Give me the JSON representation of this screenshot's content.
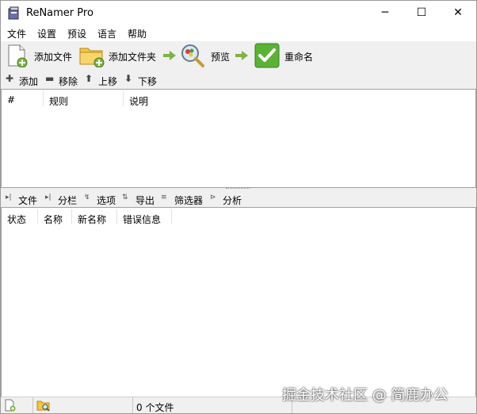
{
  "window": {
    "title": "ReNamer Pro",
    "minimize_glyph": "─",
    "maximize_glyph": "☐",
    "close_glyph": "✕"
  },
  "menu": {
    "items": [
      "文件",
      "设置",
      "预设",
      "语言",
      "帮助"
    ]
  },
  "toolbar": {
    "add_files": "添加文件",
    "add_folder": "添加文件夹",
    "preview": "预览",
    "rename": "重命名",
    "icons": [
      "add-file-icon",
      "add-folder-icon",
      "magnifier-icon",
      "checkmark-icon"
    ]
  },
  "rule_actions": {
    "add": "添加",
    "remove": "移除",
    "up": "上移",
    "down": "下移",
    "glyphs": {
      "add": "✚",
      "remove": "▬",
      "up": "⬆",
      "down": "⬇"
    }
  },
  "rules_table": {
    "columns": [
      "#",
      "规则",
      "说明"
    ],
    "rows": []
  },
  "file_tabs": {
    "items": [
      "文件",
      "分栏",
      "选项",
      "导出",
      "筛选器",
      "分析"
    ],
    "glyphs": [
      "▸|",
      "▸|",
      "↯",
      "⇅",
      "≡",
      "⊳"
    ]
  },
  "files_table": {
    "columns": [
      "状态",
      "名称",
      "新名称",
      "错误信息"
    ],
    "rows": []
  },
  "status": {
    "file_count_text": "0 个文件"
  },
  "watermark": "掘金技术社区 @ 简鹿办公",
  "colors": {
    "arrow_green": "#7cb342",
    "check_green": "#43a047",
    "folder_yellow": "#f5c542"
  }
}
